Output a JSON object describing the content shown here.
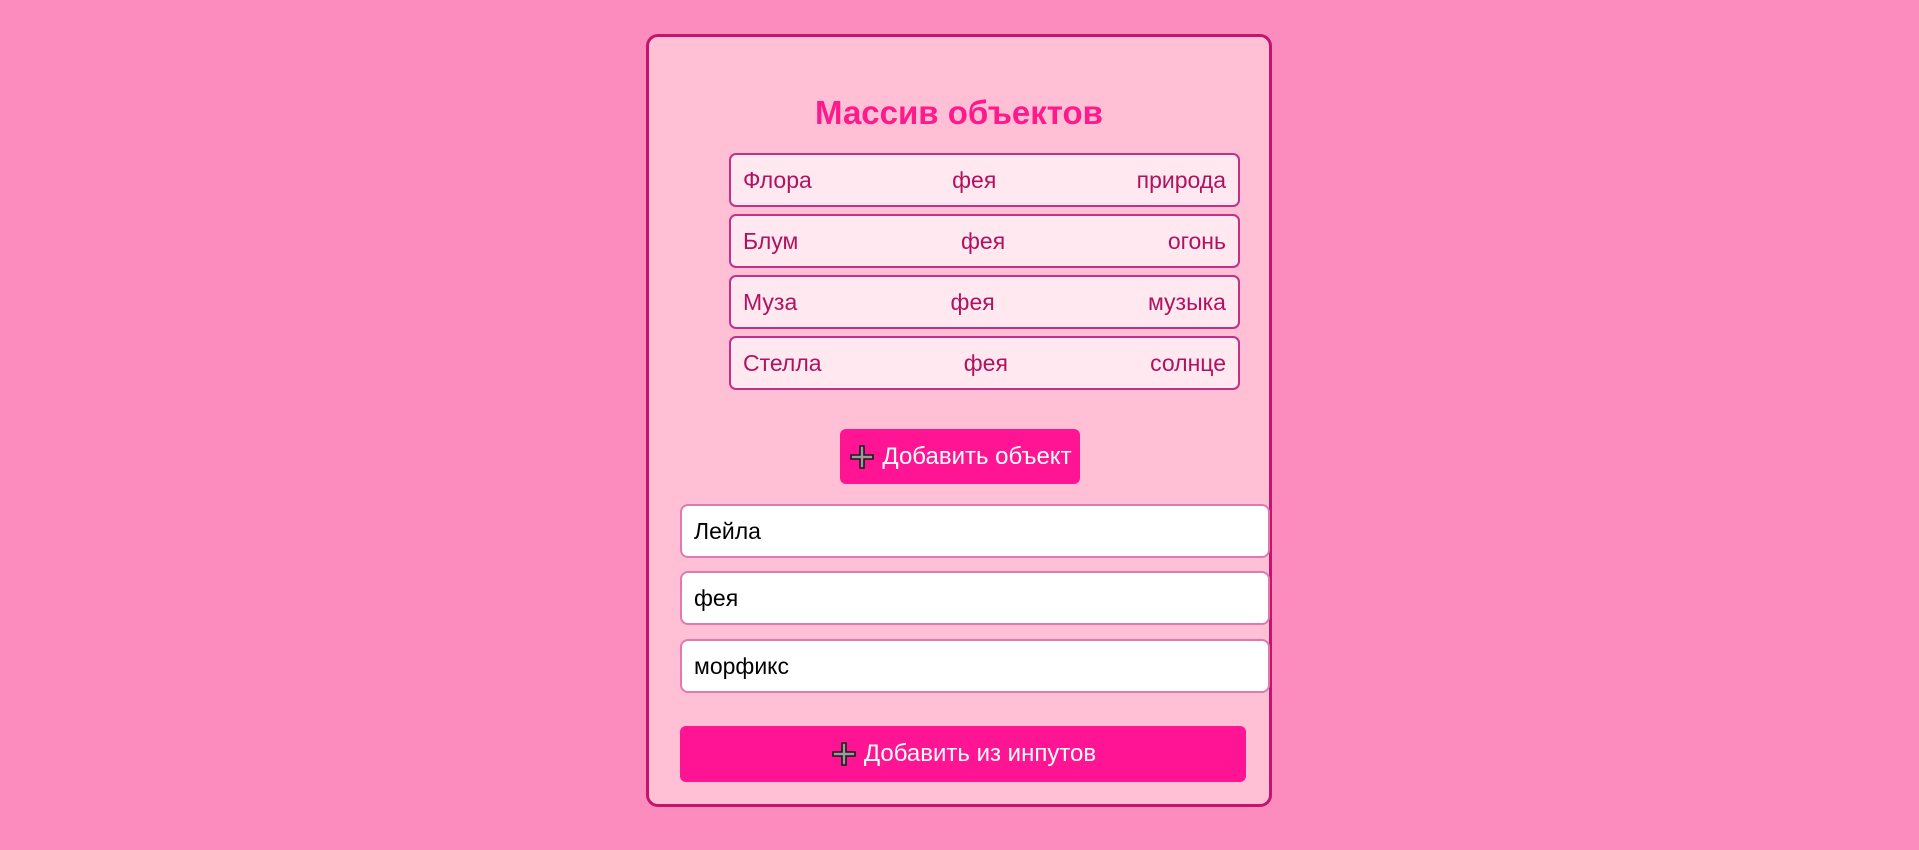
{
  "page": {
    "title": "Массив объектов"
  },
  "items": [
    {
      "name": "Флора",
      "type": "фея",
      "power": "природа"
    },
    {
      "name": "Блум",
      "type": "фея",
      "power": "огонь"
    },
    {
      "name": "Муза",
      "type": "фея",
      "power": "музыка"
    },
    {
      "name": "Стелла",
      "type": "фея",
      "power": "солнце"
    }
  ],
  "buttons": {
    "add_object": "Добавить объект",
    "add_from_inputs": "Добавить из инпутов",
    "icon": "plus-icon"
  },
  "inputs": {
    "name_value": "Лейла",
    "type_value": "фея",
    "power_value": "морфикс"
  },
  "colors": {
    "background": "#fc8cbd",
    "card": "#ffc0d6",
    "card_border": "#c4146e",
    "accent": "#ff1493",
    "title": "#ff1a8c",
    "item_bg": "#ffe8ef",
    "item_text": "#b0125f"
  }
}
